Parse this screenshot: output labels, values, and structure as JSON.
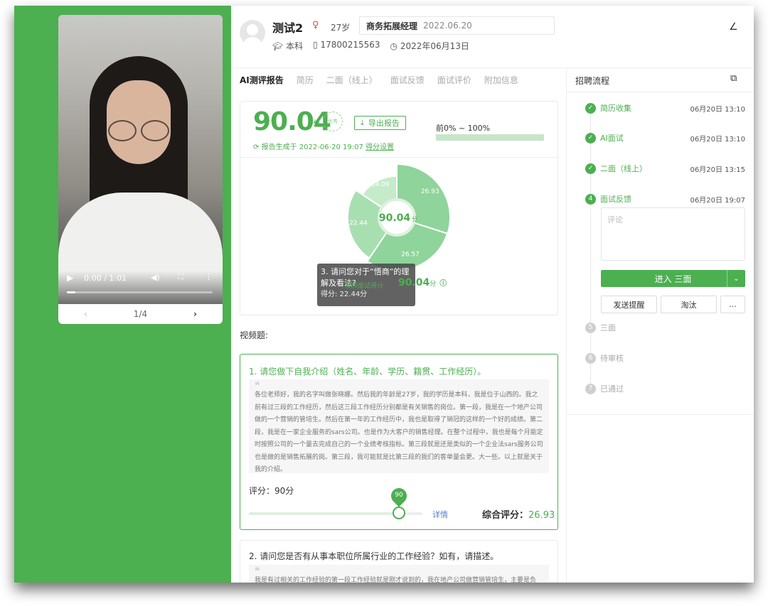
{
  "video": {
    "time": "0:00 / 1:01",
    "progress": 0.06,
    "page": "1/4"
  },
  "candidate": {
    "name": "测试2",
    "gender_icon": "female-icon",
    "age": "27岁",
    "job_title": "商务拓展经理",
    "job_date": "2022.06.20",
    "education": "本科",
    "phone": "17800215563",
    "date": "2022年06月13日"
  },
  "tabs": [
    "AI测评报告",
    "简历",
    "二面（线上）",
    "面试反馈",
    "面试评价",
    "附加信息"
  ],
  "report": {
    "score": "90.04",
    "score_unit": "分",
    "seal_text": "优秀",
    "export_label": "导出报告",
    "rank_label": "前0% ~ 100%",
    "rank_fill": 1.0,
    "generated": "报告生成于 2022-06-20 19:07",
    "score_setting": "得分设置"
  },
  "chart_data": {
    "type": "pie",
    "center_label": "90.04",
    "center_unit": "分",
    "slices": [
      {
        "label": "26.93",
        "value": 26.93,
        "color": "#8fd49a"
      },
      {
        "label": "26.57",
        "value": 26.57,
        "color": "#8fd49a"
      },
      {
        "label": "22.44",
        "value": 22.44,
        "color": "#a8dfb0"
      },
      {
        "label": "14.09",
        "value": 14.09,
        "color": "#c5ebcb"
      }
    ]
  },
  "tooltip": {
    "question": "3. 请问您对于“悟商”的理解及看法?",
    "video_score_label": "视频面试得分",
    "video_score": "90.04",
    "score_line": "得分: 22.44分"
  },
  "questions": {
    "section_label": "视频题:",
    "q1": {
      "title": "1. 请您做下自我介绍（姓名、年龄、学历、籍贯、工作经历）。",
      "quote": "各位老师好，我的名字叫做张晓娜。然后我的年龄是27岁，我的学历是本科，我是位于山西的。我之前有过三段的工作经历，然后这三段工作经历分别都是有关销售的岗位。第一段，我是在一个地产公司做的一个营销的管培生。然后在第一年的工作经历中，我也是取得了销冠的这样的一个好的成绩。第二段，我是在一家企业服务的sars公司。也是作为大客户的销售经理。在整个过程中，我也是每个月能定时按照公司的一个量去完成自己的一个业绩考核指标。第三段就是还是类似的一个企业法sars服务公司也是做的是销售拓展的岗。第三段，我可能就是比第三段的我们的客单量会更。大一些。以上就是关于我的介绍。",
      "rating_label": "评分：90分",
      "pin": "90",
      "rating": 0.9,
      "detail": "详情",
      "composite_label": "综合评分：",
      "composite_value": "26.93"
    },
    "q2": {
      "title": "2. 请问您是否有从事本职位所属行业的工作经验？如有，请描述。",
      "quote": "我是有过相关的工作经验的第一段工作经验就是刚才说到的，我在地产公司做营销管培生，主要是负"
    }
  },
  "process": {
    "title": "招聘流程",
    "steps": [
      {
        "num": "1",
        "label": "简历收集",
        "time": "06月20日 13:10"
      },
      {
        "num": "2",
        "label": "AI面试",
        "time": "06月20日 13:10"
      },
      {
        "num": "3",
        "label": "二面（线上）",
        "time": "06月20日 13:15"
      },
      {
        "num": "4",
        "label": "面试反馈",
        "time": "06月20日 19:07"
      },
      {
        "num": "5",
        "label": "三面",
        "time": ""
      },
      {
        "num": "6",
        "label": "待审核",
        "time": ""
      },
      {
        "num": "7",
        "label": "已通过",
        "time": ""
      }
    ],
    "comment_placeholder": "评论",
    "enter_label": "进入 三面",
    "remind_label": "发送提醒",
    "reject_label": "淘汰",
    "more_label": "..."
  }
}
